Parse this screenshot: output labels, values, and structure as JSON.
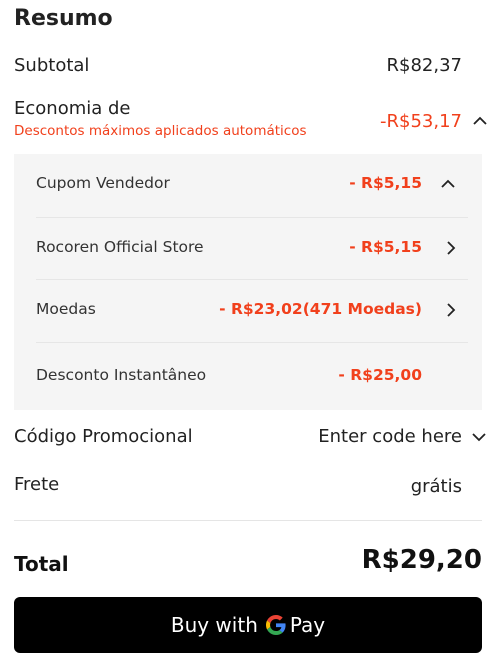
{
  "summary": {
    "title": "Resumo",
    "subtotal": {
      "label": "Subtotal",
      "value": "R$82,37"
    },
    "savings": {
      "label": "Economia de",
      "note": "Descontos máximos aplicados automáticos",
      "value": "-R$53,17",
      "items": [
        {
          "label": "Cupom Vendedor",
          "value": "- R$5,15",
          "icon": "chevron-up-icon"
        },
        {
          "label": "Rocoren Official Store",
          "value": "- R$5,15",
          "icon": "chevron-right-icon"
        },
        {
          "label": "Moedas",
          "value": "- R$23,02(471 Moedas)",
          "icon": "chevron-right-icon"
        },
        {
          "label": "Desconto Instantâneo",
          "value": "- R$25,00",
          "icon": ""
        }
      ]
    },
    "promo": {
      "label": "Código Promocional",
      "placeholder": "Enter code here"
    },
    "shipping": {
      "label": "Frete",
      "value": "grátis"
    },
    "total": {
      "label": "Total",
      "value": "R$29,20"
    }
  },
  "pay_button": {
    "prefix": "Buy with",
    "suffix": "Pay"
  },
  "colors": {
    "accent_red": "#f1401c",
    "button_bg": "#000000",
    "panel_bg": "#f5f5f5"
  }
}
